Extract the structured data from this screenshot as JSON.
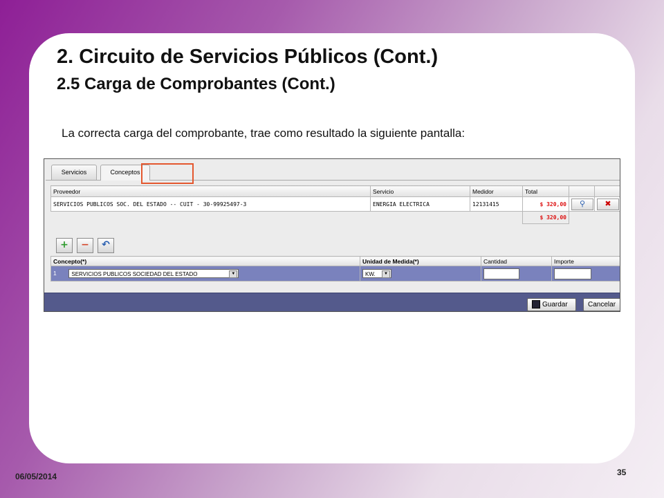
{
  "slide": {
    "title": "2. Circuito de Servicios Públicos (Cont.)",
    "subtitle": "2.5 Carga de Comprobantes (Cont.)",
    "lead_text": "La correcta carga del comprobante, trae como resultado la siguiente pantalla:",
    "date": "06/05/2014",
    "page_number": "35"
  },
  "app": {
    "tabs": [
      {
        "label": "Servicios",
        "active": false
      },
      {
        "label": "Conceptos",
        "active": true
      }
    ],
    "proveedores_table": {
      "headers": [
        "Proveedor",
        "Servicio",
        "Medidor",
        "Total"
      ],
      "row": {
        "proveedor": "SERVICIOS PUBLICOS SOC. DEL ESTADO -- CUIT - 30-99925497-3",
        "servicio": "ENERGIA ELECTRICA",
        "medidor": "12131415",
        "total": "$ 320,00"
      },
      "grand_total": "$ 320,00"
    },
    "conceptos_table": {
      "headers": [
        "Concepto(*)",
        "Unidad de Medida(*)",
        "Cantidad",
        "Importe"
      ],
      "row": {
        "index": "1",
        "concepto": "SERVICIOS PUBLICOS SOCIEDAD DEL ESTADO",
        "unidad": "KW.",
        "cantidad": "",
        "importe": ""
      }
    },
    "buttons": {
      "save": "Guardar",
      "cancel": "Cancelar"
    },
    "icons": {
      "add": "add-icon",
      "remove": "remove-icon",
      "undo": "undo-icon",
      "search": "search-icon",
      "delete": "delete-icon",
      "save": "save-disk-icon"
    },
    "colors": {
      "accent_row": "#7a82bd",
      "total_text": "#d11111",
      "highlight_box": "#e4572e"
    }
  }
}
